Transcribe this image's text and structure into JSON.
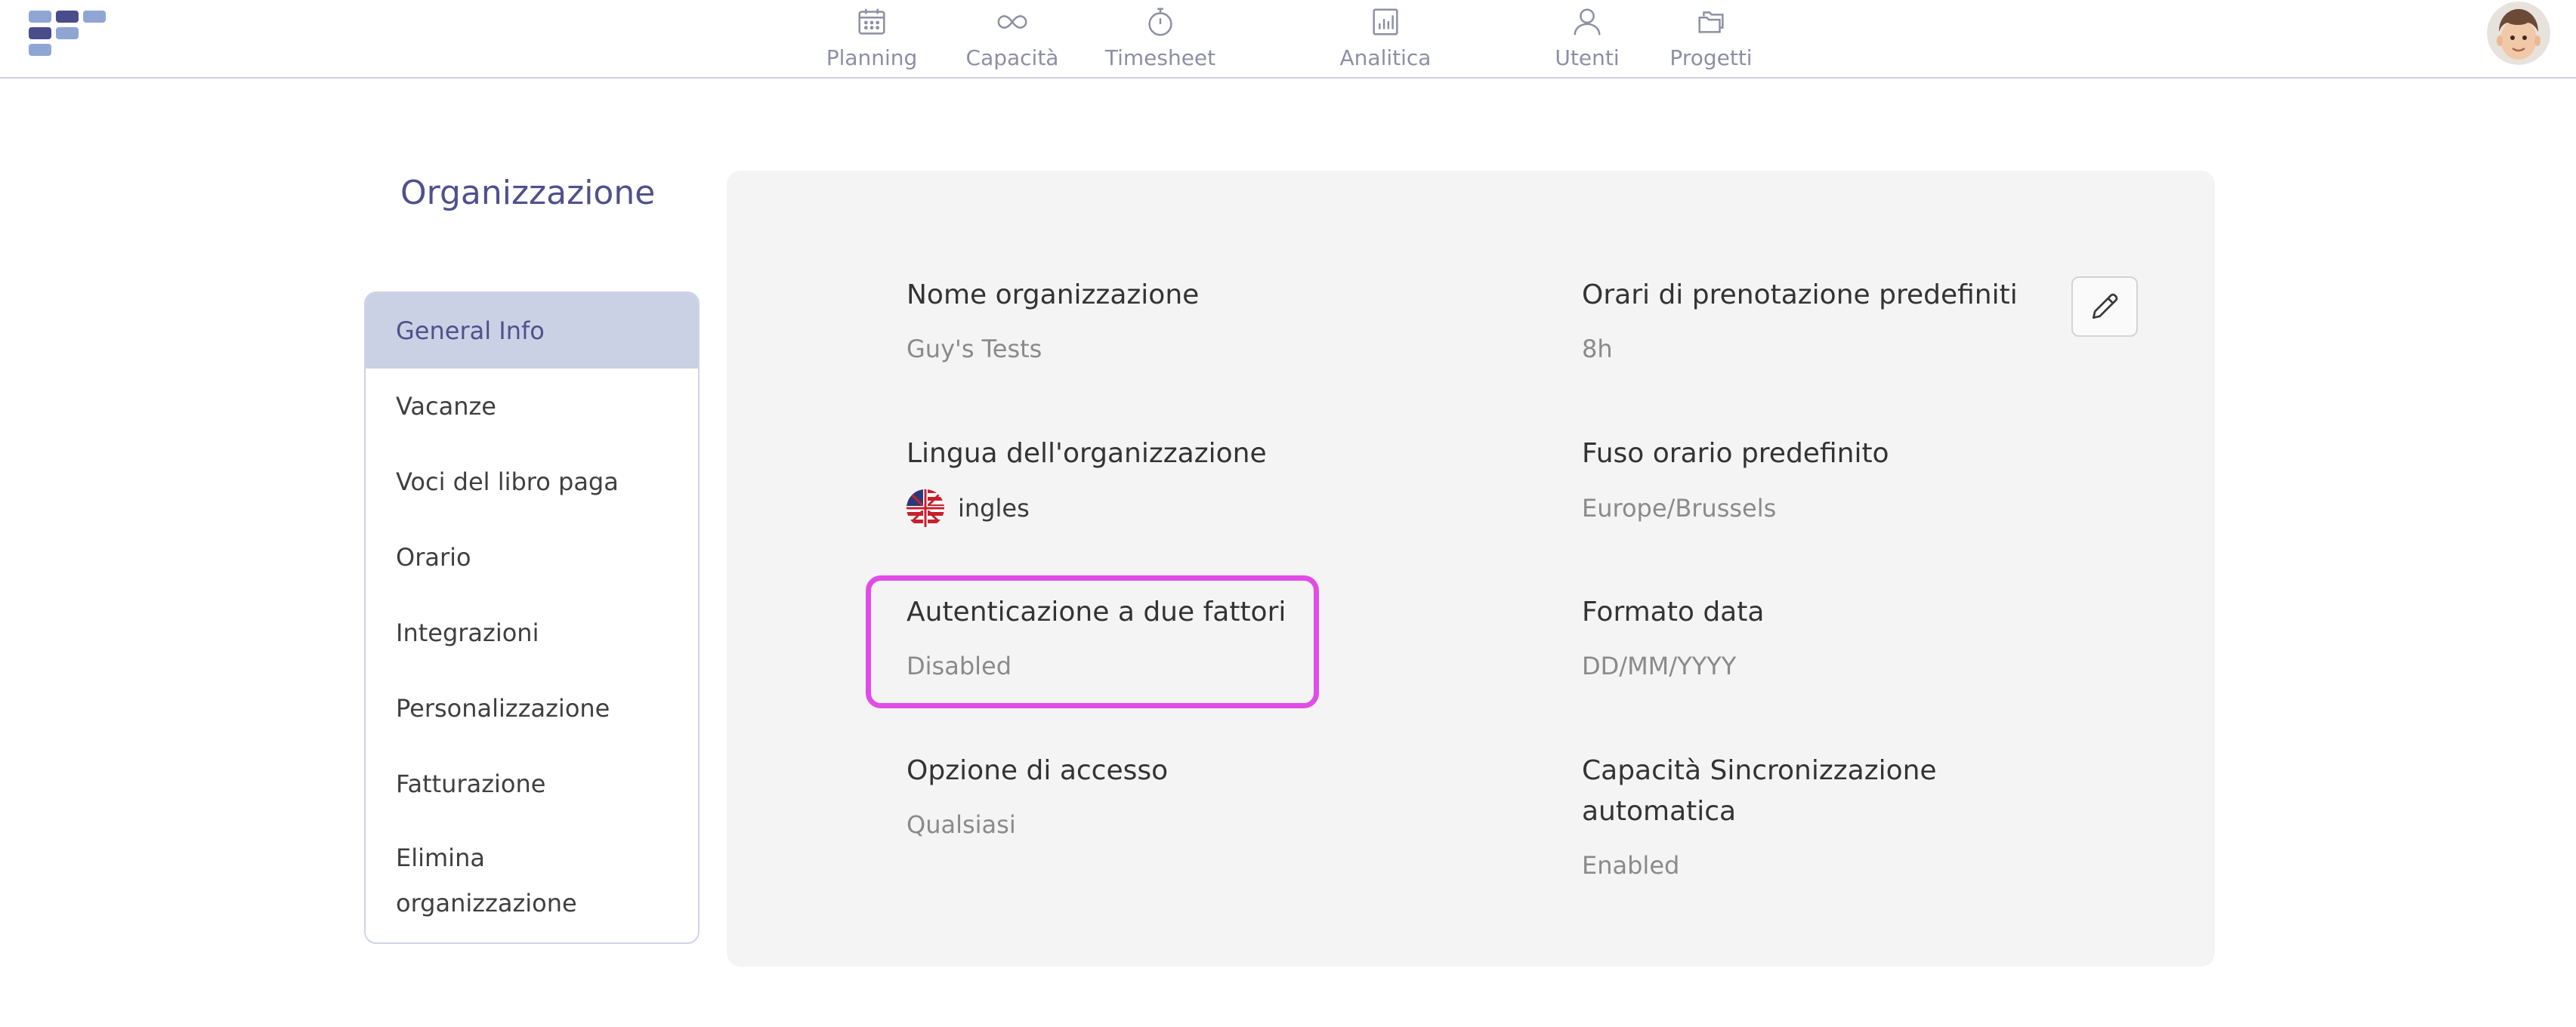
{
  "nav": {
    "items": [
      {
        "label": "Planning",
        "icon": "calendar-icon"
      },
      {
        "label": "Capacità",
        "icon": "infinity-icon"
      },
      {
        "label": "Timesheet",
        "icon": "stopwatch-icon"
      },
      {
        "label": "Analitica",
        "icon": "bar-chart-icon"
      },
      {
        "label": "Utenti",
        "icon": "user-icon"
      },
      {
        "label": "Progetti",
        "icon": "folders-icon"
      }
    ]
  },
  "sidebar": {
    "title": "Organizzazione",
    "items": [
      {
        "label": "General Info",
        "active": true
      },
      {
        "label": "Vacanze"
      },
      {
        "label": "Voci del libro paga"
      },
      {
        "label": "Orario"
      },
      {
        "label": "Integrazioni"
      },
      {
        "label": "Personalizzazione"
      },
      {
        "label": "Fatturazione"
      },
      {
        "label": "Elimina organizzazione"
      }
    ]
  },
  "fields": {
    "org_name": {
      "label": "Nome organizzazione",
      "value": "Guy's Tests"
    },
    "booking_hours": {
      "label": "Orari di prenotazione predefiniti",
      "value": "8h"
    },
    "language": {
      "label": "Lingua dell'organizzazione",
      "value": "ingles",
      "icon": "us-flag-icon"
    },
    "timezone": {
      "label": "Fuso orario predefinito",
      "value": "Europe/Brussels"
    },
    "two_factor": {
      "label": "Autenticazione a due fattori",
      "value": "Disabled"
    },
    "date_format": {
      "label": "Formato data",
      "value": "DD/MM/YYYY"
    },
    "access": {
      "label": "Opzione di accesso",
      "value": "Qualsiasi"
    },
    "auto_sync": {
      "label_line1": "Capacità Sincronizzazione",
      "label_line2": "automatica",
      "value": "Enabled"
    }
  },
  "colors": {
    "accent": "#4f518c",
    "active_bg": "#cad1e5",
    "highlight": "#e14ce6",
    "panel_bg": "#f4f4f4"
  }
}
